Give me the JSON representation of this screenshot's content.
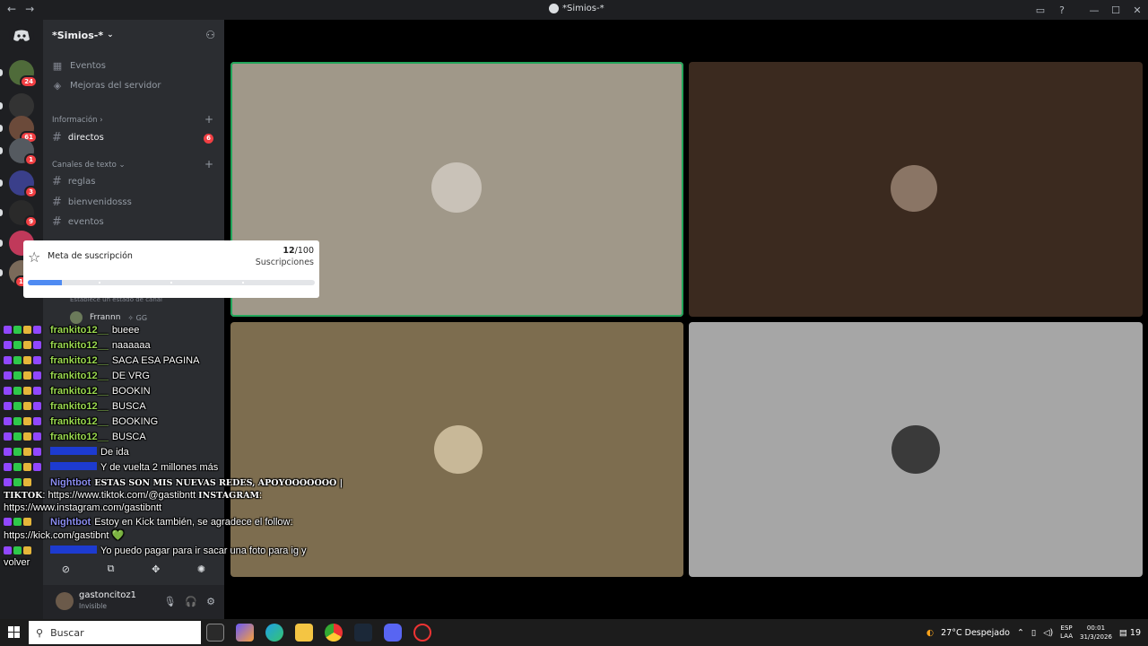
{
  "window": {
    "title": "*Simios-*",
    "controls": [
      "▭",
      "?",
      "—",
      "☐",
      "✕"
    ]
  },
  "guilds": [
    {
      "badge": "24",
      "color": "#4f6b3a"
    },
    {
      "badge": "",
      "color": "#333333"
    },
    {
      "badge": "61",
      "color": "#6b4a3a"
    },
    {
      "badge": "1",
      "color": "#555a60"
    },
    {
      "badge": "3",
      "color": "#3a3f8a"
    },
    {
      "badge": "9",
      "color": "#2a2a2a"
    },
    {
      "badge": "",
      "color": "#c0395a"
    },
    {
      "badge": "1K+",
      "color": "#7a6a5a"
    }
  ],
  "server": {
    "name": "*Simios-*",
    "items": [
      {
        "label": "Eventos",
        "icon": "calendar-icon"
      },
      {
        "label": "Mejoras del servidor",
        "icon": "boost-icon"
      }
    ],
    "categories": {
      "info": "Información",
      "text": "Canales de texto"
    },
    "channels": {
      "directos": "directos",
      "directos_badge": "6",
      "reglas": "reglas",
      "bienvenidos": "bienvenidosss",
      "eventos": "eventos"
    },
    "voice_user": "Frrannn",
    "voice_user_tag": "GG",
    "voice_hint": "Establece un estado de canal"
  },
  "user": {
    "name": "gastoncitoz1",
    "status": "Invisible"
  },
  "overlay": {
    "label": "Meta de suscripción",
    "current": "12",
    "total": "/100",
    "sub": "Suscripciones",
    "progress": 0.12
  },
  "chat": [
    {
      "nick": "frankito12__",
      "msg": "bueee"
    },
    {
      "nick": "frankito12__",
      "msg": "naaaaaa"
    },
    {
      "nick": "frankito12__",
      "msg": "SACA ESA PAGINA"
    },
    {
      "nick": "frankito12__",
      "msg": "DE VRG"
    },
    {
      "nick": "frankito12__",
      "msg": "BOOKIN"
    },
    {
      "nick": "frankito12__",
      "msg": "BUSCA"
    },
    {
      "nick": "frankito12__",
      "msg": "BOOKING"
    },
    {
      "nick": "frankito12__",
      "msg": "BUSCA"
    },
    {
      "nick": "",
      "msg": "De ida"
    },
    {
      "nick": "",
      "msg": "Y de vuelta 2 millones más"
    }
  ],
  "chat_bot1": {
    "nick": "Nightbot",
    "line1": "ESTAS SON MIS NUEVAS REDES, APOYOOOOOOO |",
    "line2a": "TIKTOK",
    "line2b": ": https://www.tiktok.com/@gastibntt",
    "line2c": "INSTAGRAM",
    "line2d": ":",
    "line3": "https://www.instagram.com/gastibntt"
  },
  "chat_bot2": {
    "nick": "Nightbot",
    "line1": "Estoy en Kick también, se agradece el follow:",
    "line2": "https://kick.com/gastibnt",
    "heart": "💚"
  },
  "chat_last": {
    "line1": "Yo puedo pagar para ir sacar una foto para ig y",
    "line2": "volver"
  },
  "tiles": [
    {
      "bg": "#a09889",
      "avatar": "#c9c2b8",
      "speaking": true
    },
    {
      "bg": "#3b2a1f",
      "avatar": "#8a7565",
      "speaking": false
    },
    {
      "bg": "#7d6d4f",
      "avatar": "#c8b898",
      "speaking": false
    },
    {
      "bg": "#a6a6a6",
      "avatar": "#3a3a3a",
      "speaking": false
    }
  ],
  "taskbar": {
    "search": "Buscar",
    "weather": "27°C  Despejado",
    "lang1": "ESP",
    "lang2": "LAA",
    "time": "00:01",
    "date": "31/3/2026",
    "notif": "19"
  }
}
